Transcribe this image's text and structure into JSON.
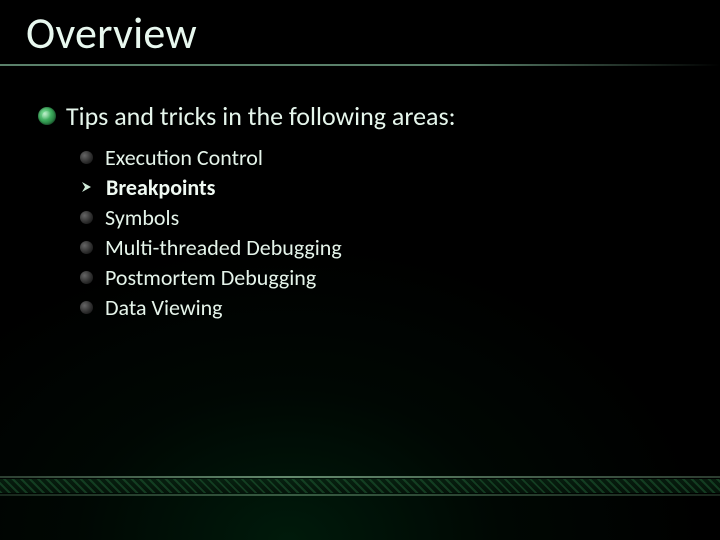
{
  "title": "Overview",
  "intro": "Tips and tricks in the following areas:",
  "items": [
    {
      "label": "Execution Control",
      "current": false
    },
    {
      "label": "Breakpoints",
      "current": true
    },
    {
      "label": "Symbols",
      "current": false
    },
    {
      "label": "Multi-threaded Debugging",
      "current": false
    },
    {
      "label": "Postmortem Debugging",
      "current": false
    },
    {
      "label": "Data Viewing",
      "current": false
    }
  ],
  "colors": {
    "accent": "#3aa85a",
    "text": "#e6f6ec"
  }
}
